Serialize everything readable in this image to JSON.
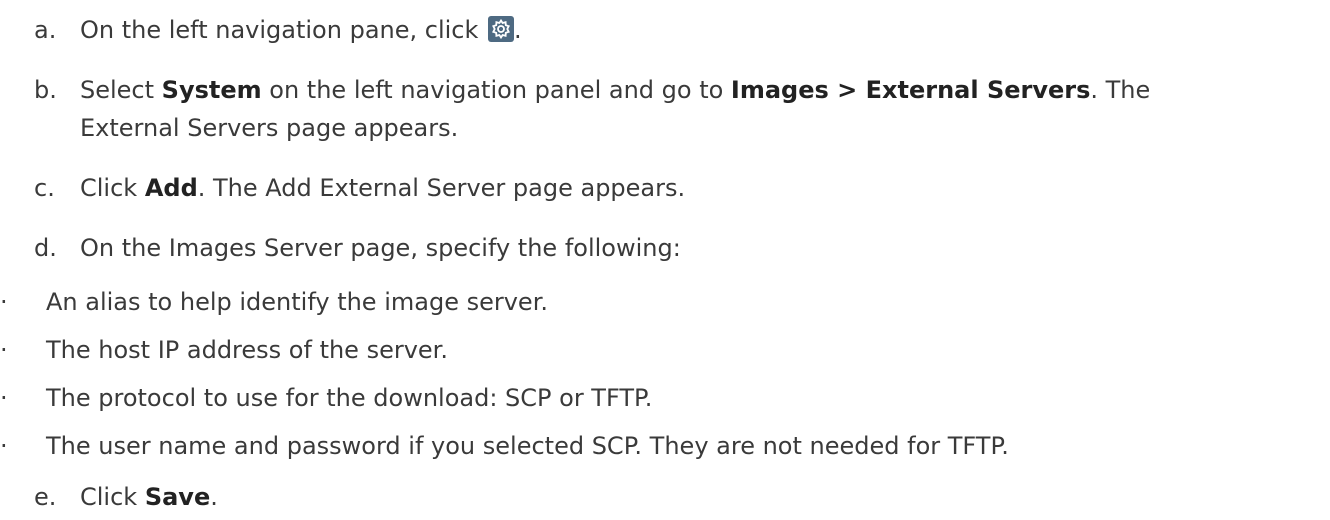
{
  "steps": {
    "a": {
      "marker": "a.",
      "text": "On the left navigation pane, click",
      "after_icon": ".",
      "icon": "gear-icon"
    },
    "b": {
      "marker": "b.",
      "pre": "Select ",
      "bold1": "System",
      "mid": " on the left navigation panel and go to ",
      "bold2": "Images > External Servers",
      "post": ". The",
      "line2": "External Servers page appears."
    },
    "c": {
      "marker": "c.",
      "pre": "Click ",
      "bold": "Add",
      "post": ". The Add External Server page appears."
    },
    "d": {
      "marker": "d.",
      "text": "On the Images Server page, specify the following:"
    },
    "e": {
      "marker": "e.",
      "pre": "Click ",
      "bold": "Save",
      "post": "."
    }
  },
  "bullets": [
    {
      "dot": "·",
      "text": "An alias to help identify the image server."
    },
    {
      "dot": "·",
      "text": "The host IP address of the server."
    },
    {
      "dot": "·",
      "text": "The protocol to use for the download: SCP or TFTP."
    },
    {
      "dot": "·",
      "text": "The user name and password if you selected SCP. They are not needed for TFTP."
    }
  ],
  "colors": {
    "text": "#3a3a3a",
    "icon_bg": "#4e6a82"
  }
}
